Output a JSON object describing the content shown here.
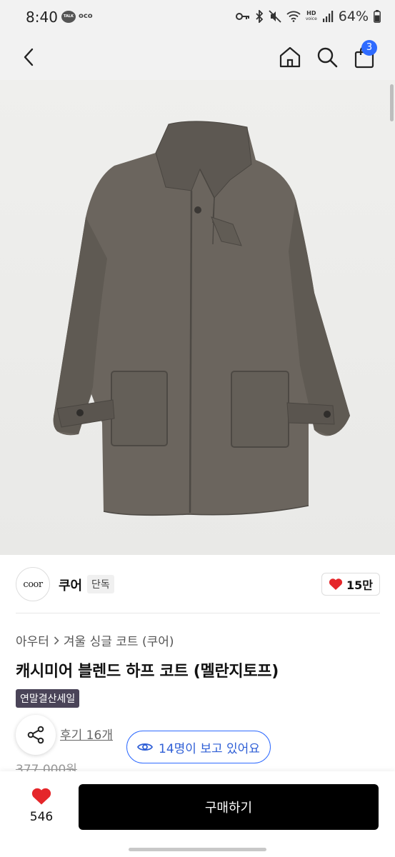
{
  "status_bar": {
    "time": "8:40",
    "talk_label": "TALK",
    "oco_label": "oco",
    "hd_label": "HD",
    "voice_label": "voice",
    "battery": "64%"
  },
  "header": {
    "cart_count": "3",
    "icons": [
      "back-arrow-icon",
      "home-icon",
      "search-icon",
      "shopping-bag-icon"
    ]
  },
  "product_image": {
    "icon": "coat-image"
  },
  "brand": {
    "logo_text": "coor",
    "name": "쿠어",
    "tag": "단독",
    "likes": "15만"
  },
  "breadcrumb": {
    "category": "아우터",
    "separator_icon": "chevron-right-icon",
    "subcategory": "겨울 싱글 코트 (쿠어)"
  },
  "product": {
    "title": "캐시미어 블렌드 하프 코트 (멜란지토프)",
    "sale_badge": "연말결산세일",
    "reviews": "후기 16개",
    "viewers": "14명이 보고 있어요",
    "original_price": "377,000원"
  },
  "bottom_bar": {
    "wish_count": "546",
    "buy_label": "구매하기"
  },
  "colors": {
    "accent_blue": "#2f6bff",
    "heart_red": "#e5262a",
    "sale_badge_bg": "#4a4458",
    "buy_button_bg": "#000000"
  }
}
